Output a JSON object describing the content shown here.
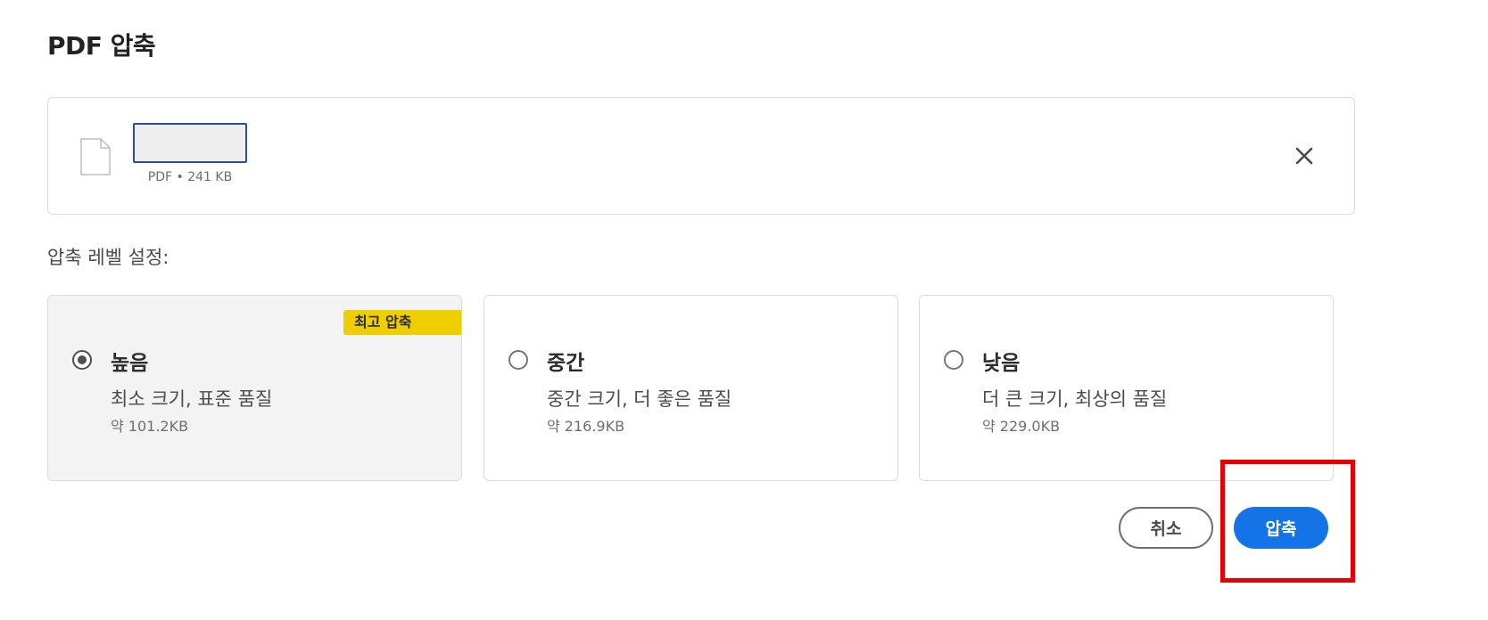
{
  "dialog": {
    "title": "PDF 압축"
  },
  "file": {
    "meta": "PDF • 241 KB",
    "icon": "file-icon",
    "close_icon": "close-icon"
  },
  "compression": {
    "label": "압축 레벨 설정:",
    "options": [
      {
        "title": "높음",
        "description": "최소 크기, 표준 품질",
        "size": "약 101.2KB",
        "badge": "최고 압축",
        "selected": true
      },
      {
        "title": "중간",
        "description": "중간 크기, 더 좋은 품질",
        "size": "약 216.9KB",
        "selected": false
      },
      {
        "title": "낮음",
        "description": "더 큰 크기, 최상의 품질",
        "size": "약 229.0KB",
        "selected": false
      }
    ]
  },
  "actions": {
    "cancel_label": "취소",
    "compress_label": "압축"
  },
  "colors": {
    "primary_button": "#1473e6",
    "badge": "#efce00",
    "highlight": "#e60000",
    "selected_card": "#f3f3f3"
  }
}
